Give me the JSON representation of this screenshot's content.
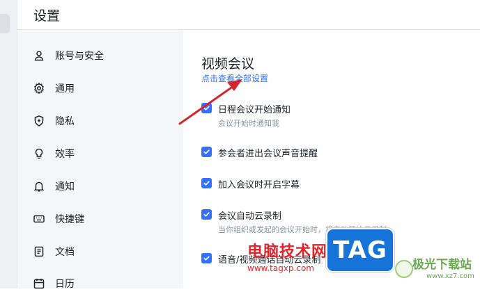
{
  "header": {
    "title": "设置"
  },
  "sidebar": {
    "items": [
      {
        "label": "账号与安全",
        "icon": "user-icon"
      },
      {
        "label": "通用",
        "icon": "gear-icon"
      },
      {
        "label": "隐私",
        "icon": "shield-icon"
      },
      {
        "label": "效率",
        "icon": "lightbulb-icon"
      },
      {
        "label": "通知",
        "icon": "bell-icon"
      },
      {
        "label": "快捷键",
        "icon": "keyboard-icon"
      },
      {
        "label": "文档",
        "icon": "document-icon"
      },
      {
        "label": "日历",
        "icon": "calendar-icon"
      }
    ]
  },
  "main": {
    "section_title": "视频会议",
    "view_all_link": "点击查看全部设置",
    "options": [
      {
        "label": "日程会议开始通知",
        "desc": "会议开始时通知我",
        "checked": true
      },
      {
        "label": "参会者进出会议声音提醒",
        "checked": true
      },
      {
        "label": "加入会议时开启字幕",
        "checked": true
      },
      {
        "label": "会议自动云录制",
        "desc": "当你组织或发起的会议开始时，将自动开始云录制",
        "checked": true
      },
      {
        "label": "语音/视频通话自动云录制",
        "checked": true
      }
    ]
  },
  "watermark": {
    "site_name": "电脑技术网",
    "url": "www.tagxp.com",
    "tag": "TAG",
    "right_name": "极光下载站",
    "right_url": "www.xz7.com"
  },
  "colors": {
    "accent": "#3370ff",
    "annotation_arrow": "#d0282e"
  }
}
